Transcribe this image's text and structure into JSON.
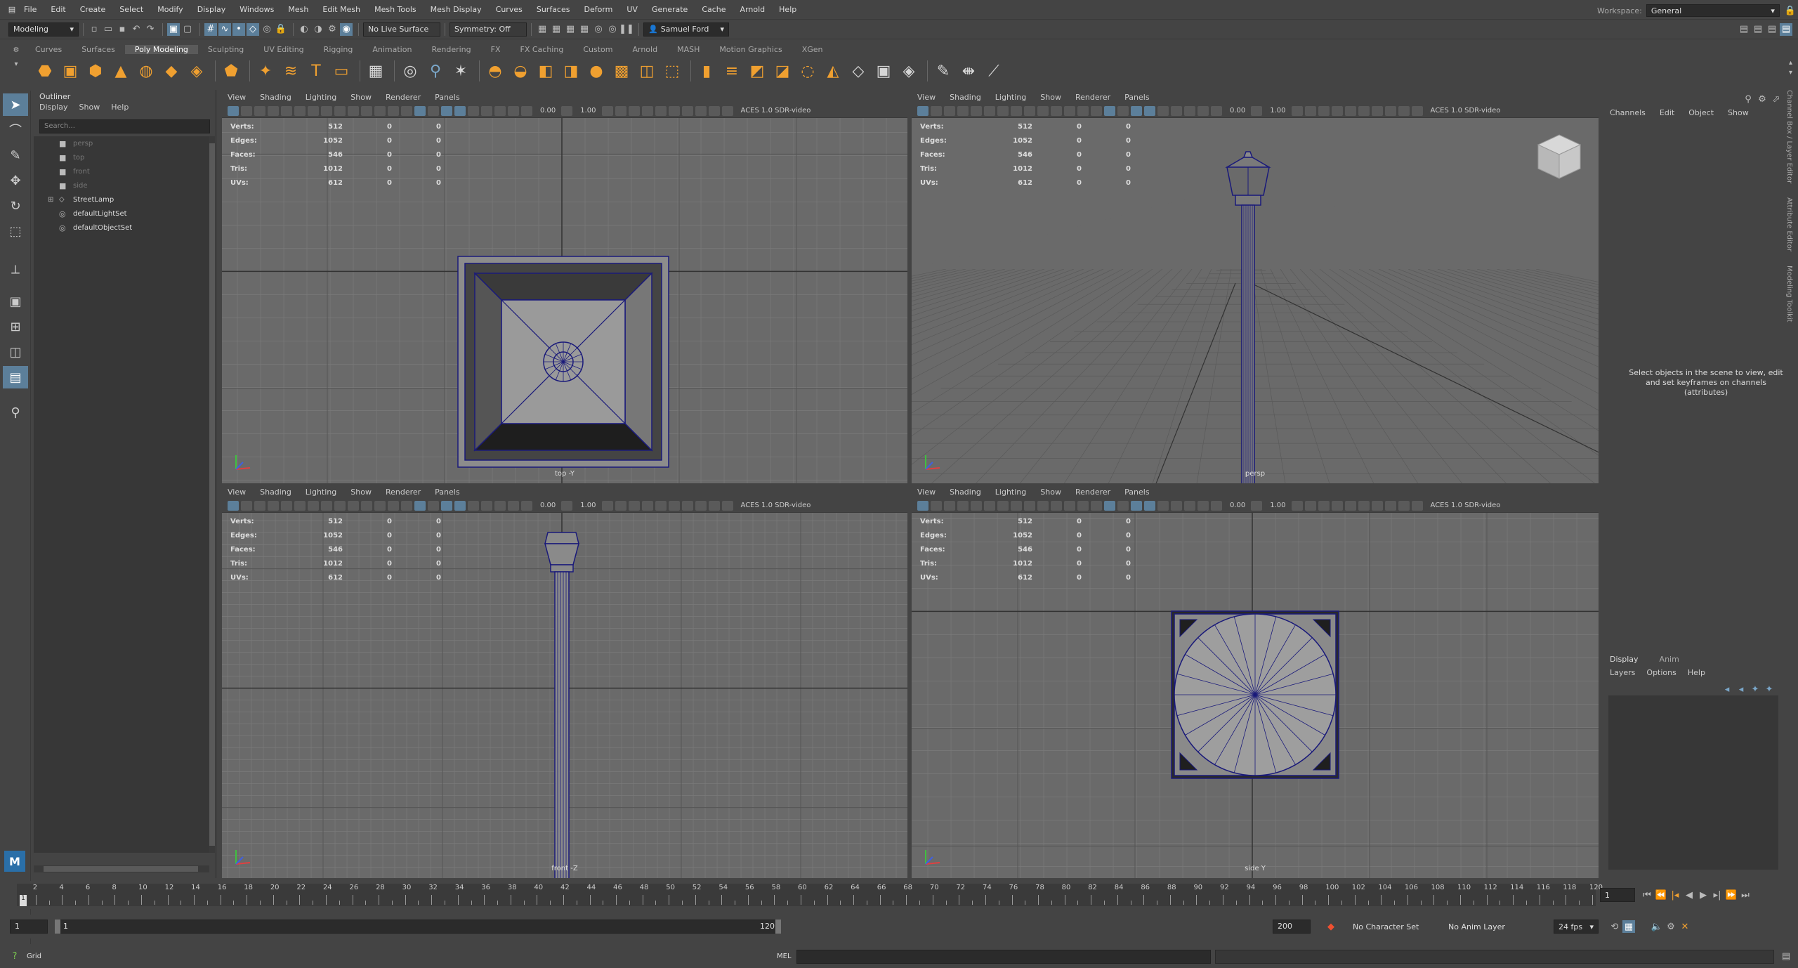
{
  "menubar": {
    "items": [
      "File",
      "Edit",
      "Create",
      "Select",
      "Modify",
      "Display",
      "Windows",
      "Mesh",
      "Edit Mesh",
      "Mesh Tools",
      "Mesh Display",
      "Curves",
      "Surfaces",
      "Deform",
      "UV",
      "Generate",
      "Cache",
      "Arnold",
      "Help"
    ],
    "workspace_label": "Workspace:",
    "workspace_value": "General"
  },
  "statusline": {
    "mode": "Modeling",
    "live_surface": "No Live Surface",
    "symmetry": "Symmetry: Off",
    "user": "Samuel Ford"
  },
  "shelf": {
    "tabs": [
      "Curves",
      "Surfaces",
      "Poly Modeling",
      "Sculpting",
      "UV Editing",
      "Rigging",
      "Animation",
      "Rendering",
      "FX",
      "FX Caching",
      "Custom",
      "Arnold",
      "MASH",
      "Motion Graphics",
      "XGen"
    ],
    "active_tab": "Poly Modeling"
  },
  "outliner": {
    "title": "Outliner",
    "menu": [
      "Display",
      "Show",
      "Help"
    ],
    "search_placeholder": "Search...",
    "items": [
      {
        "label": "persp",
        "icon": "camera-icon",
        "dim": true
      },
      {
        "label": "top",
        "icon": "camera-icon",
        "dim": true
      },
      {
        "label": "front",
        "icon": "camera-icon",
        "dim": true
      },
      {
        "label": "side",
        "icon": "camera-icon",
        "dim": true
      },
      {
        "label": "StreetLamp",
        "icon": "transform-icon",
        "dim": false
      },
      {
        "label": "defaultLightSet",
        "icon": "set-icon",
        "dim": false
      },
      {
        "label": "defaultObjectSet",
        "icon": "set-icon",
        "dim": false
      }
    ]
  },
  "viewport_menu": [
    "View",
    "Shading",
    "Lighting",
    "Show",
    "Renderer",
    "Panels"
  ],
  "viewport_tools": {
    "exposure": "0.00",
    "gamma": "1.00",
    "colorspace": "ACES 1.0 SDR-video"
  },
  "hud": {
    "labels": [
      "Verts:",
      "Edges:",
      "Faces:",
      "Tris:",
      "UVs:"
    ],
    "values": [
      "512",
      "1052",
      "546",
      "1012",
      "612"
    ],
    "zero": "0"
  },
  "viewports": {
    "top": "top -Y",
    "persp": "persp",
    "front": "front -Z",
    "side": "side Y"
  },
  "channelbox": {
    "menu": [
      "Channels",
      "Edit",
      "Object",
      "Show"
    ],
    "message": "Select objects in the scene to view, edit and set keyframes on channels (attributes)"
  },
  "layers": {
    "tabs": [
      "Display",
      "Anim"
    ],
    "menu": [
      "Layers",
      "Options",
      "Help"
    ]
  },
  "side_tabs": [
    "Channel Box / Layer Editor",
    "Attribute Editor",
    "Modeling Toolkit"
  ],
  "timeline": {
    "ticks": [
      "2",
      "4",
      "6",
      "8",
      "10",
      "12",
      "14",
      "16",
      "18",
      "20",
      "22",
      "24",
      "26",
      "28",
      "30",
      "32",
      "34",
      "36",
      "38",
      "40",
      "42",
      "44",
      "46",
      "48",
      "50",
      "52",
      "54",
      "56",
      "58",
      "60",
      "62",
      "64",
      "66",
      "68",
      "70",
      "72",
      "74",
      "76",
      "78",
      "80",
      "82",
      "84",
      "86",
      "88",
      "90",
      "92",
      "94",
      "96",
      "98",
      "100",
      "102",
      "104",
      "106",
      "108",
      "110",
      "112",
      "114",
      "116",
      "118",
      "120"
    ],
    "current": "1",
    "current_field": "1"
  },
  "range": {
    "start": "1",
    "inner_start": "1",
    "inner_end": "120",
    "end": "200",
    "character_set": "No Character Set",
    "anim_layer": "No Anim Layer",
    "fps": "24 fps"
  },
  "cmdline": {
    "help_text": "Grid",
    "mel_label": "MEL"
  },
  "colors": {
    "wire": "#1a1a7a",
    "accent": "#5c7f9a",
    "shelf_icon": "#f0a030"
  }
}
